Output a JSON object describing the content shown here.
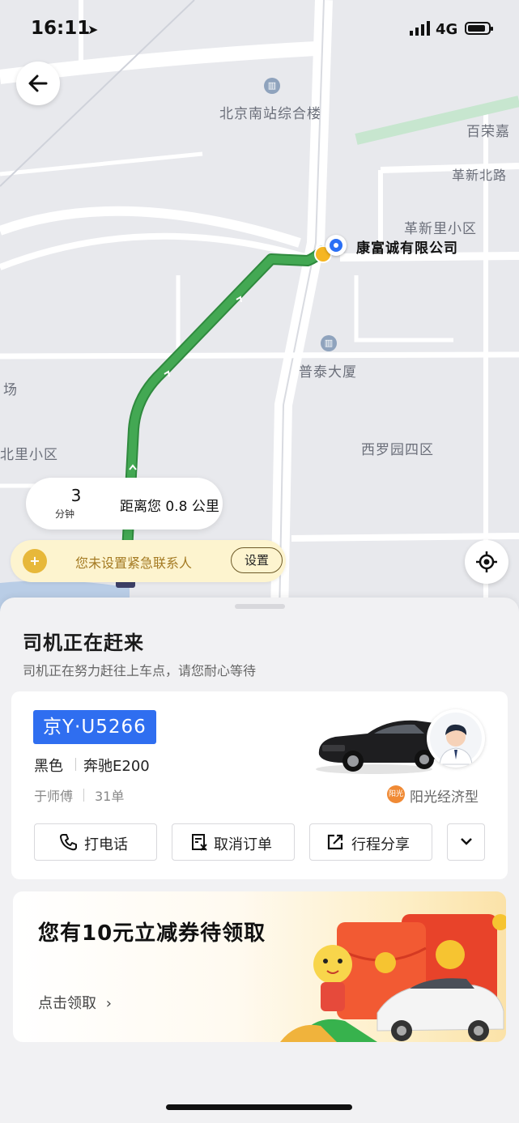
{
  "status_bar": {
    "time": "16:11",
    "network": "4G"
  },
  "map": {
    "labels": {
      "south_station_building": "北京南站综合楼",
      "bairongjia": "百荣嘉",
      "gexin_north_road": "革新北路",
      "gexinli": "革新里小区",
      "putai": "普泰大厦",
      "xiluoyuan": "西罗园四区",
      "beili": "北里小区",
      "chang": "场"
    },
    "destination_name": "康富诚有限公司",
    "eta": {
      "minutes": "3",
      "minutes_unit": "分钟",
      "distance_text": "距离您 0.8 公里"
    },
    "emergency": {
      "text": "您未设置紧急联系人",
      "button": "设置"
    }
  },
  "sheet": {
    "title": "司机正在赶来",
    "subtitle": "司机正在努力赶往上车点，请您耐心等待",
    "driver": {
      "plate": "京Y·U5266",
      "color": "黑色",
      "model": "奔驰E200",
      "name": "于师傅",
      "orders": "31单",
      "service_badge": "阳光",
      "service_type": "阳光经济型"
    },
    "actions": {
      "call": "打电话",
      "cancel": "取消订单",
      "share": "行程分享"
    },
    "promo": {
      "title": "您有10元立减券待领取",
      "link": "点击领取"
    }
  },
  "colors": {
    "route": "#3a9b4a",
    "plate_bg": "#2f6ef0",
    "emergency_bg": "#fdf4cf",
    "emergency_text": "#a47a22",
    "pin_blue": "#2a6ff5"
  }
}
